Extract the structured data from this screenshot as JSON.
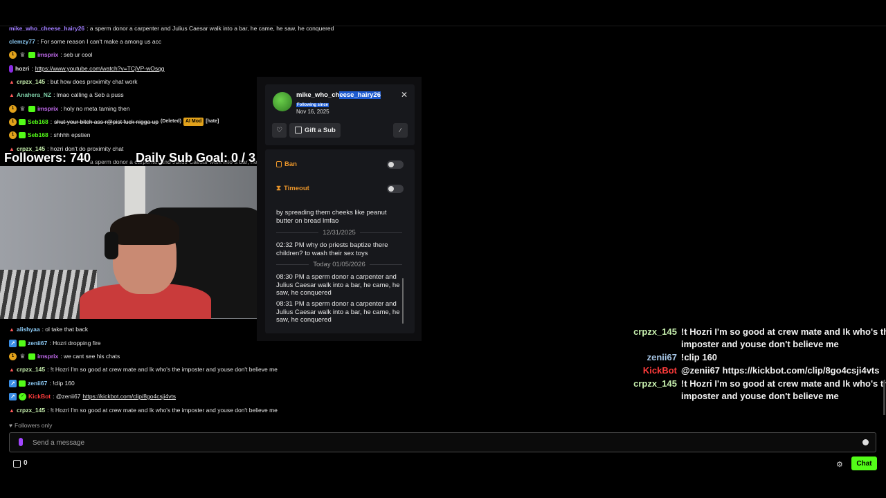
{
  "chat": {
    "messages_top": [
      {
        "user": "mike_who_cheese_hairy26",
        "user_color": "#a07cff",
        "text": ": a sperm donor a carpenter and Julius Caesar walk into a bar, he came, he saw, he conquered"
      },
      {
        "user": "clemzy77",
        "user_color": "#8ecdf8",
        "text": ": For some reason I can't make a among us acc"
      },
      {
        "user": "imsprix",
        "user_color": "#c46cf0",
        "text": ": seb ur cool"
      },
      {
        "user": "hozri",
        "user_color": "#e6e6e6",
        "text": ": ",
        "link": "https://www.youtube.com/watch?v=TCjVP-wOsqg"
      },
      {
        "user": "crpzx_145",
        "user_color": "#c9f2b0",
        "text": ": but how does proximity chat work"
      },
      {
        "user": "Anahera_NZ",
        "user_color": "#7ed0a8",
        "text": ": lmao calling a Seb a puss"
      },
      {
        "user": "imsprix",
        "user_color": "#c46cf0",
        "text": ": holy no meta taming then"
      },
      {
        "user": "Seb168",
        "user_color": "#53fc18",
        "text": "shut your bitch ass r@pist fuck nigga up",
        "deleted": "(Deleted)",
        "mod_tag": "AI Mod",
        "tag": "[hate]"
      },
      {
        "user": "Seb168",
        "user_color": "#53fc18",
        "text": ": shhhh epstien"
      },
      {
        "user": "crpzx_145",
        "user_color": "#c9f2b0",
        "text": ": hozri don't do proximity chat"
      },
      {
        "user": "",
        "user_color": "#a07cff",
        "text": "a sperm donor a carpenter and Julius Caesar walk into a bar, he c"
      }
    ],
    "messages_bottom": [
      {
        "user": "alishyaa",
        "user_color": "#8ecdf8",
        "text": ": ol take that back"
      },
      {
        "user": "zenii67",
        "user_color": "#8ecdf8",
        "text": ": Hozri dropping fire"
      },
      {
        "user": "imsprix",
        "user_color": "#c46cf0",
        "text": ": we cant see his chats"
      },
      {
        "user": "crpzx_145",
        "user_color": "#c9f2b0",
        "text": ": !t Hozri I'm so good at crew mate and Ik who's the imposter and youse don't believe me"
      },
      {
        "user": "zenii67",
        "user_color": "#8ecdf8",
        "text": ": !clip 160"
      },
      {
        "user": "KickBot",
        "user_color": "#ff3b3b",
        "text": ": @zenii67 ",
        "link": "https://kickbot.com/clip/8go4csji4vts"
      },
      {
        "user": "crpzx_145",
        "user_color": "#c9f2b0",
        "text": ": !t Hozri I'm so good at crew mate and Ik who's the imposter and youse don't believe me"
      }
    ]
  },
  "overlay": {
    "followers": "Followers: 740",
    "sub_goal": "Daily Sub Goal:  0 / 3"
  },
  "user_card": {
    "username_plain": "mike_who_ch",
    "username_highlight": "eese_hairy26",
    "following_label": "Following since",
    "following_date": "Nov 16, 2025",
    "gift_label": "Gift a Sub",
    "close": "✕"
  },
  "moderation": {
    "ban_label": "Ban",
    "timeout_label": "Timeout",
    "history": {
      "msg0": "by spreading them cheeks like peanut butter on bread lmfao",
      "date1": "12/31/2025",
      "msg1": "02:32 PM why do priests baptize there children? to wash their sex toys",
      "date2": "Today 01/05/2026",
      "msg2": "08:30 PM a sperm donor a carpenter and Julius Caesar walk into a bar, he came, he saw, he conquered",
      "msg3": "08:31 PM a sperm donor a carpenter and Julius Caesar walk into a bar, he came, he saw, he conquered"
    }
  },
  "right_chat": [
    {
      "user": "crpzx_145",
      "user_color": "#c9f2b0",
      "lines": [
        "!t Hozri I'm so good at crew mate and Ik who's the",
        "imposter and youse don't believe me"
      ]
    },
    {
      "user": "zenii67",
      "user_color": "#a8c8e8",
      "lines": [
        "!clip 160"
      ]
    },
    {
      "user": "KickBot",
      "user_color": "#ff3b3b",
      "lines": [
        "@zenii67 https://kickbot.com/clip/8go4csji4vts"
      ]
    },
    {
      "user": "crpzx_145",
      "user_color": "#c9f2b0",
      "lines": [
        "!t Hozri I'm so good at crew mate and Ik who's the",
        "imposter and youse don't believe me"
      ]
    }
  ],
  "footer": {
    "followers_only": "Followers only",
    "input_placeholder": "Send a message",
    "points": "0",
    "chat_button": "Chat"
  }
}
